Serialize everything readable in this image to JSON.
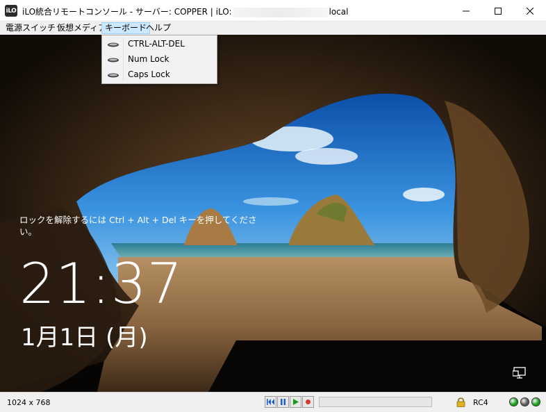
{
  "window": {
    "logo_text": "iLO",
    "title_prefix": "iLO統合リモートコンソール - サーバー: COPPER | iLO:",
    "title_suffix": "local"
  },
  "menubar": {
    "items": [
      {
        "label": "電源スイッチ"
      },
      {
        "label": "仮想メディア"
      },
      {
        "label": "キーボード"
      },
      {
        "label": "ヘルプ"
      }
    ]
  },
  "keyboard_menu": {
    "items": [
      {
        "label": "CTRL-ALT-DEL",
        "icon": "keyboard-icon"
      },
      {
        "label": "Num Lock",
        "icon": "keyboard-icon"
      },
      {
        "label": "Caps Lock",
        "icon": "keyboard-icon"
      }
    ]
  },
  "lock_screen": {
    "message": "ロックを解除するには Ctrl + Alt + Del キーを押してください。",
    "time": "21:37",
    "date": "1月1日 (月)",
    "network_icon": "network-icon"
  },
  "statusbar": {
    "resolution": "1024 x 768",
    "playback_buttons": [
      "skip-to-start-icon",
      "pause-icon",
      "play-icon",
      "record-icon"
    ],
    "progress_fraction": 0,
    "encryption": "RC4",
    "indicators": [
      {
        "name": "health-indicator-green",
        "color": "#1aa01a"
      },
      {
        "name": "activity-indicator",
        "color": "#5a5a5a"
      },
      {
        "name": "power-indicator",
        "color": "#1aa01a"
      }
    ]
  },
  "colors": {
    "menu_active_bg": "#cce8ff",
    "dropdown_bg": "#f2f2f2",
    "status_bg": "#f0f0f0"
  }
}
